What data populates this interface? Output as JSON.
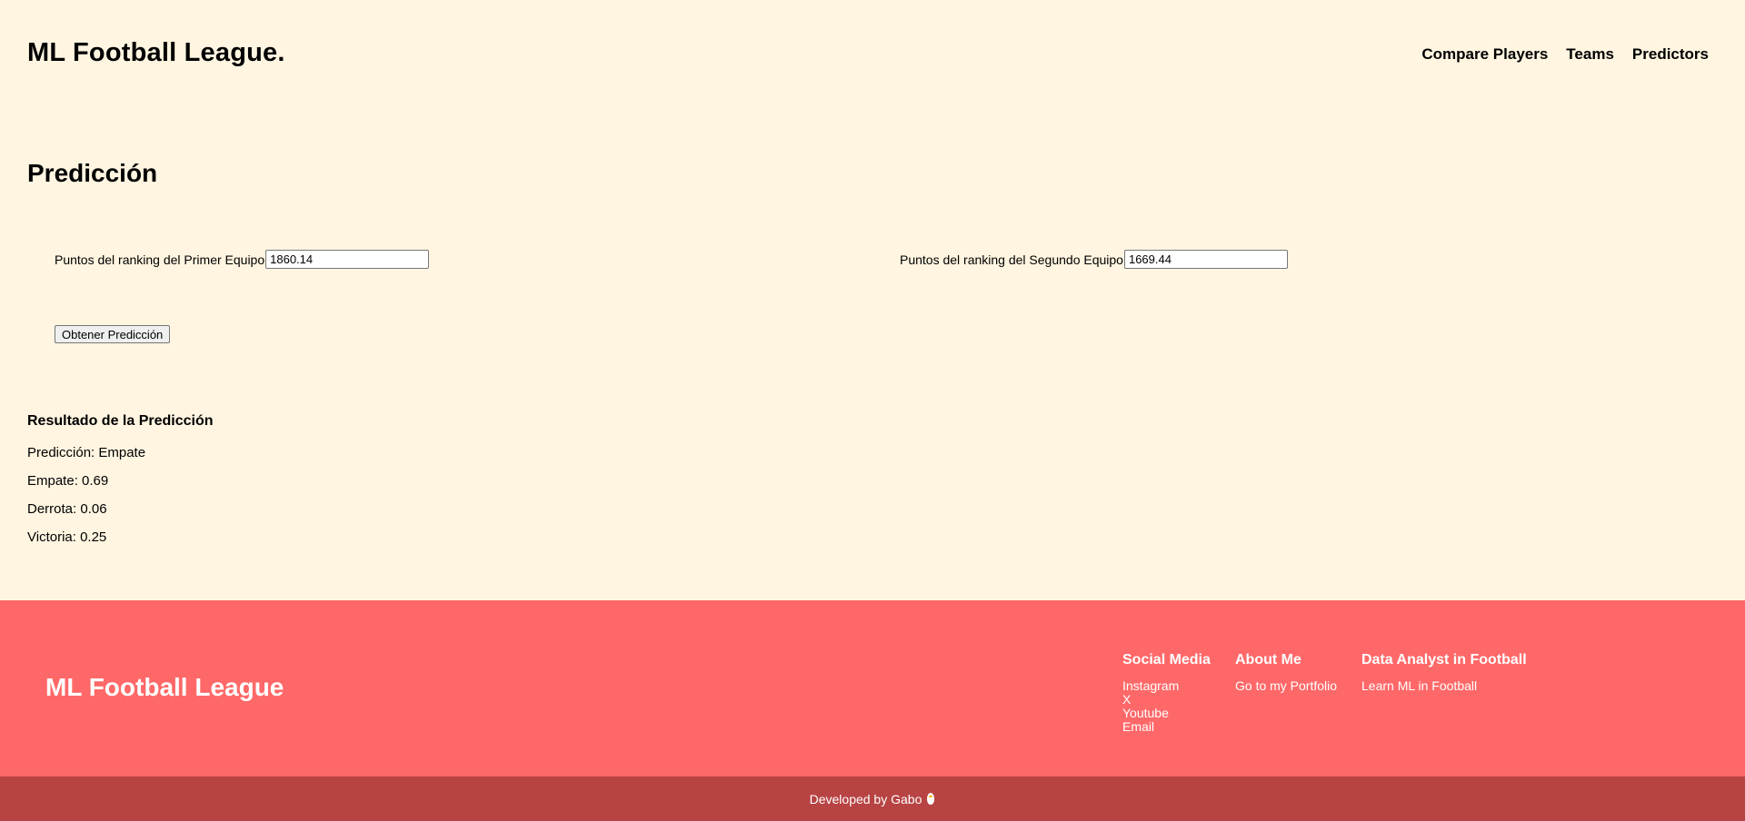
{
  "header": {
    "brand": "ML Football League.",
    "nav": [
      "Compare Players",
      "Teams",
      "Predictors"
    ]
  },
  "main": {
    "title": "Predicción",
    "form": {
      "team1_label": "Puntos del ranking del Primer Equipo",
      "team1_value": "1860.14",
      "team2_label": "Puntos del ranking del Segundo Equipo",
      "team2_value": "1669.44",
      "submit_label": "Obtener Predicción"
    },
    "result": {
      "title": "Resultado de la Predicción",
      "lines": [
        "Predicción: Empate",
        "Empate: 0.69",
        "Derrota: 0.06",
        "Victoria: 0.25"
      ]
    }
  },
  "footer": {
    "brand": "ML Football League",
    "columns": [
      {
        "title": "Social Media",
        "links": [
          "Instagram",
          "X",
          "Youtube",
          "Email"
        ]
      },
      {
        "title": "About Me",
        "links": [
          "Go to my Portfolio"
        ]
      },
      {
        "title": "Data Analyst in Football",
        "links": [
          "Learn ML in Football"
        ]
      }
    ],
    "credit": "Developed by Gabo",
    "credit_icon": "penguin-icon"
  },
  "colors": {
    "background": "#fff5e1",
    "footer": "#ff6868",
    "bottom_bar": "#b84343"
  }
}
